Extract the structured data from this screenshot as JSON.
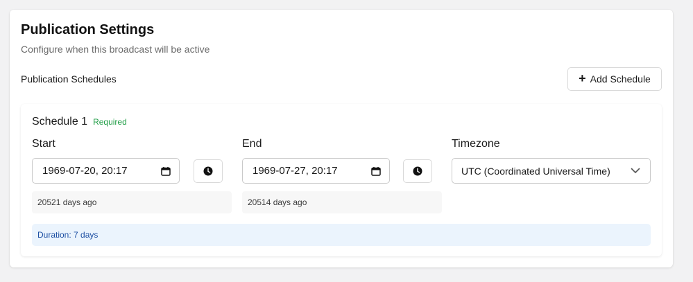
{
  "header": {
    "title": "Publication Settings",
    "subtitle": "Configure when this broadcast will be active"
  },
  "schedules_section": {
    "label": "Publication Schedules",
    "add_button_label": "Add Schedule",
    "add_button_icon": "plus-icon"
  },
  "schedule": {
    "title": "Schedule 1",
    "required_badge": "Required",
    "required_color": "#1f9d45",
    "start": {
      "label": "Start",
      "value": "1969-07-20, 20:17",
      "relative": "20521 days ago"
    },
    "end": {
      "label": "End",
      "value": "1969-07-27, 20:17",
      "relative": "20514 days ago"
    },
    "timezone": {
      "label": "Timezone",
      "selected": "UTC (Coordinated Universal Time)"
    },
    "duration": "Duration: 7 days",
    "duration_color": "#1d4fa3",
    "duration_bg": "#ebf4fd"
  }
}
